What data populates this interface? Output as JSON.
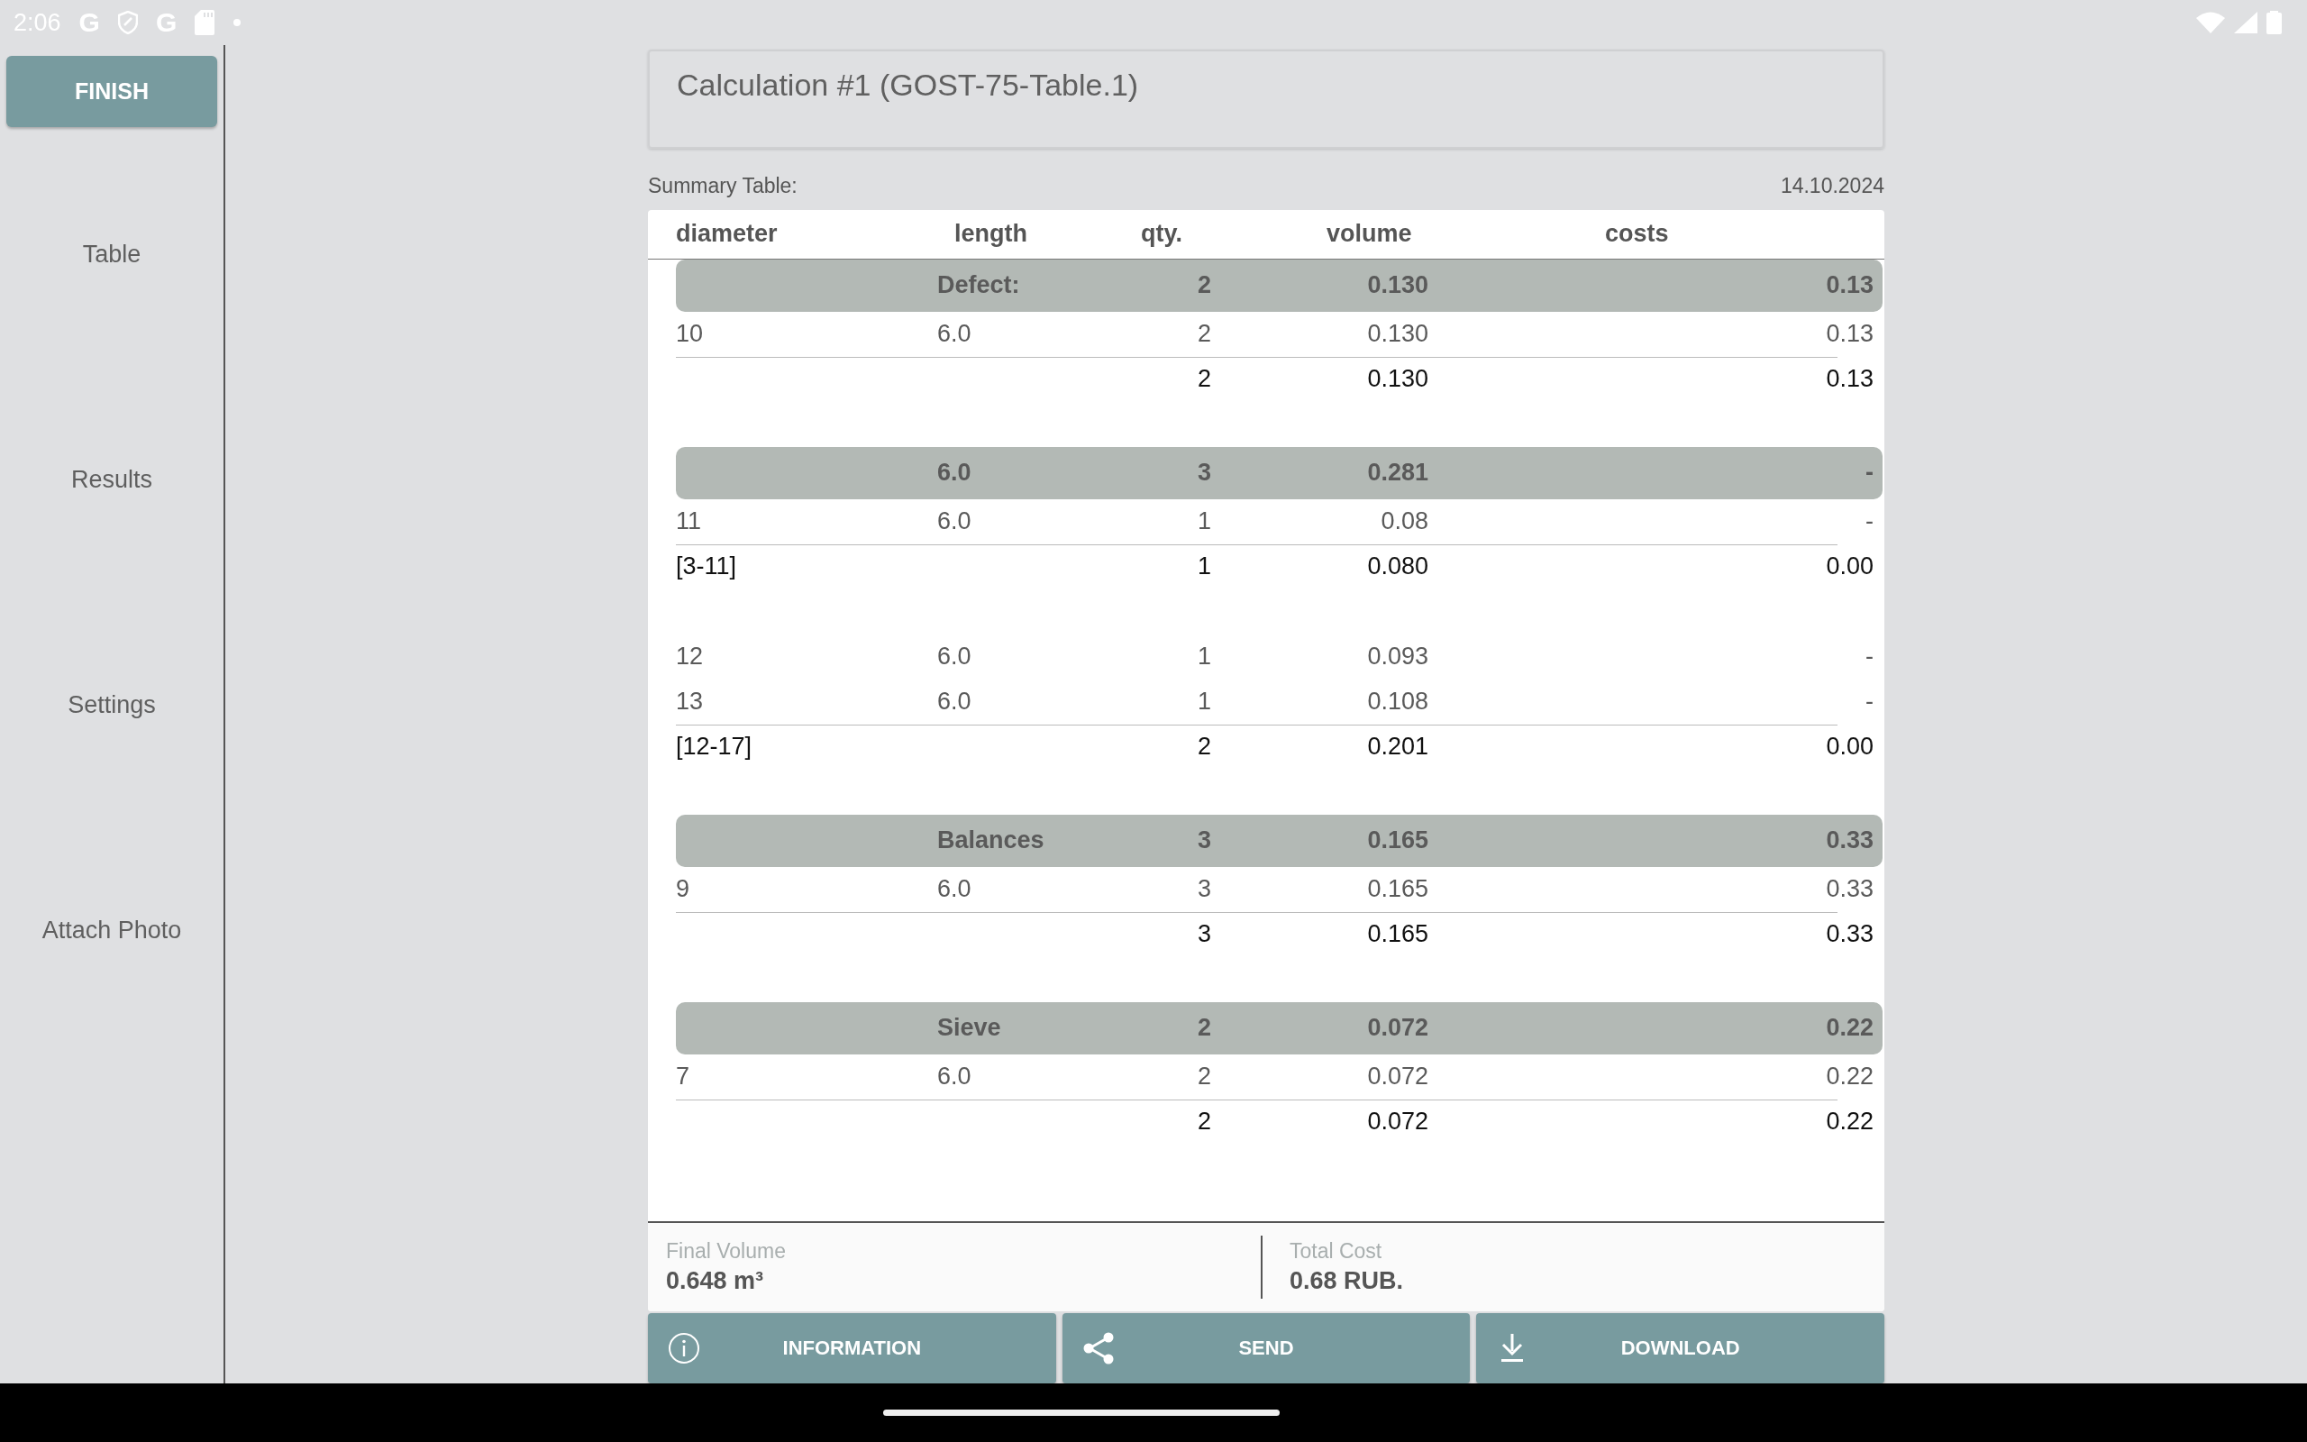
{
  "status_bar": {
    "time": "2:06",
    "notifications": [
      {
        "kind": "letter",
        "text": "G"
      },
      {
        "kind": "shield"
      },
      {
        "kind": "letter",
        "text": "G"
      },
      {
        "kind": "sdcard"
      },
      {
        "kind": "dot"
      }
    ]
  },
  "sidebar": {
    "finish_button": "FINISH",
    "items": [
      "Table",
      "Results",
      "Settings",
      "Attach Photo"
    ]
  },
  "title": "Calculation #1 (GOST-75-Table.1)",
  "summary_label": "Summary Table:",
  "date": "14.10.2024",
  "table": {
    "columns": [
      "diameter",
      "length",
      "qty.",
      "volume",
      "costs"
    ],
    "groups": [
      {
        "header": {
          "length": "Defect:",
          "qty": "2",
          "volume": "0.130",
          "costs": "0.13"
        },
        "items": [
          {
            "diameter": "10",
            "length": "6.0",
            "qty": "2",
            "volume": "0.130",
            "costs": "0.13"
          }
        ],
        "total": {
          "qty": "2",
          "volume": "0.130",
          "costs": "0.13"
        }
      },
      {
        "header": {
          "length": "6.0",
          "qty": "3",
          "volume": "0.281",
          "costs": "-"
        },
        "items": [
          {
            "diameter": "11",
            "length": "6.0",
            "qty": "1",
            "volume": "0.08",
            "costs": "-"
          }
        ],
        "total": {
          "diameter": "[3-11]",
          "qty": "1",
          "volume": "0.080",
          "costs": "0.00"
        }
      },
      {
        "items": [
          {
            "diameter": "12",
            "length": "6.0",
            "qty": "1",
            "volume": "0.093",
            "costs": "-"
          },
          {
            "diameter": "13",
            "length": "6.0",
            "qty": "1",
            "volume": "0.108",
            "costs": "-"
          }
        ],
        "total": {
          "diameter": "[12-17]",
          "qty": "2",
          "volume": "0.201",
          "costs": "0.00"
        }
      },
      {
        "header": {
          "length": "Balances",
          "qty": "3",
          "volume": "0.165",
          "costs": "0.33"
        },
        "items": [
          {
            "diameter": "9",
            "length": "6.0",
            "qty": "3",
            "volume": "0.165",
            "costs": "0.33"
          }
        ],
        "total": {
          "qty": "3",
          "volume": "0.165",
          "costs": "0.33"
        }
      },
      {
        "header": {
          "length": "Sieve",
          "qty": "2",
          "volume": "0.072",
          "costs": "0.22"
        },
        "items": [
          {
            "diameter": "7",
            "length": "6.0",
            "qty": "2",
            "volume": "0.072",
            "costs": "0.22"
          }
        ],
        "total": {
          "qty": "2",
          "volume": "0.072",
          "costs": "0.22"
        }
      }
    ]
  },
  "summary": [
    {
      "label": "Final Volume",
      "value": "0.648 m³"
    },
    {
      "label": "Total Cost",
      "value": "0.68 RUB."
    }
  ],
  "buttons": [
    {
      "kind": "info",
      "label": "INFORMATION"
    },
    {
      "kind": "share",
      "label": "SEND"
    },
    {
      "kind": "download",
      "label": "DOWNLOAD"
    }
  ]
}
